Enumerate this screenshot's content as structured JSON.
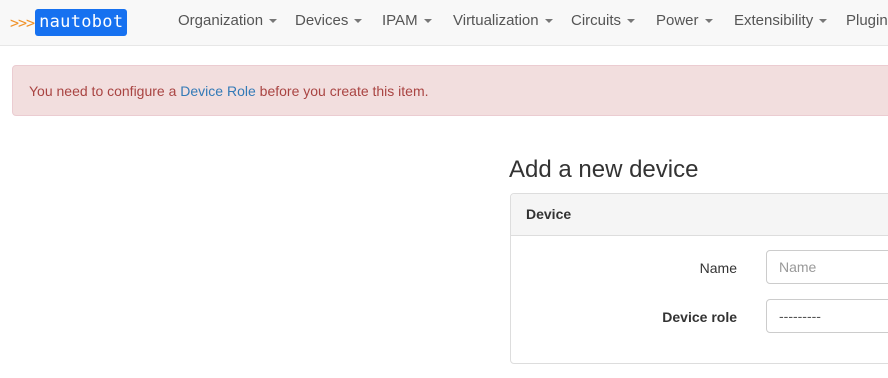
{
  "brand": {
    "arrows": ">>>",
    "name": "nautobot"
  },
  "nav": {
    "items": [
      {
        "label": "Organization"
      },
      {
        "label": "Devices"
      },
      {
        "label": "IPAM"
      },
      {
        "label": "Virtualization"
      },
      {
        "label": "Circuits"
      },
      {
        "label": "Power"
      },
      {
        "label": "Extensibility"
      },
      {
        "label": "Plugins"
      }
    ]
  },
  "alert": {
    "prefix": "You need to configure a ",
    "link": "Device Role",
    "suffix": " before you create this item."
  },
  "page": {
    "title": "Add a new device"
  },
  "panel": {
    "heading": "Device",
    "fields": {
      "name": {
        "label": "Name",
        "placeholder": "Name",
        "value": ""
      },
      "device_role": {
        "label": "Device role",
        "value": "---------"
      }
    }
  },
  "colors": {
    "brand_blue": "#1671f0",
    "brand_orange": "#f0932b",
    "alert_bg": "#f2dede",
    "alert_text": "#a94442",
    "link": "#337ab7"
  }
}
